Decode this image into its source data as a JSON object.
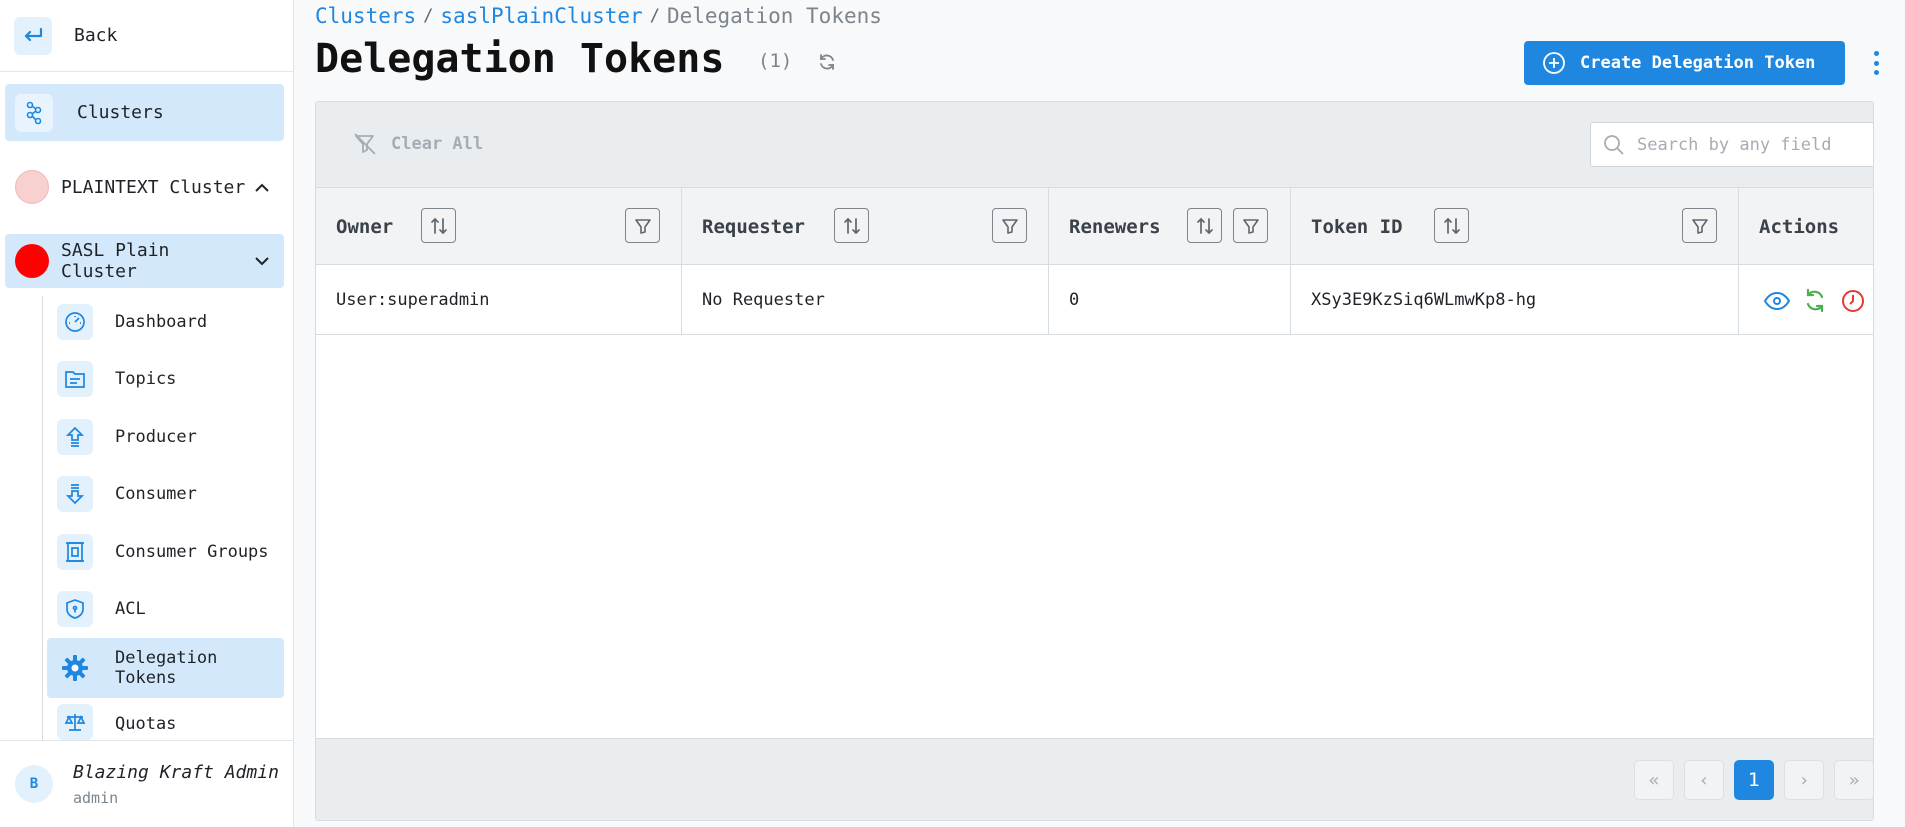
{
  "sidebar": {
    "back_label": "Back",
    "clusters_label": "Clusters",
    "clusters": [
      {
        "name": "PLAINTEXT Cluster",
        "color": "#f8d0d0",
        "expanded": false
      },
      {
        "name": "SASL Plain Cluster",
        "color": "#ff0000",
        "expanded": true
      }
    ],
    "nav_items": [
      {
        "label": "Dashboard",
        "icon": "gauge-icon"
      },
      {
        "label": "Topics",
        "icon": "folder-icon"
      },
      {
        "label": "Producer",
        "icon": "upload-arrow-icon"
      },
      {
        "label": "Consumer",
        "icon": "download-arrow-icon"
      },
      {
        "label": "Consumer Groups",
        "icon": "group-icon"
      },
      {
        "label": "ACL",
        "icon": "shield-icon"
      },
      {
        "label": "Delegation Tokens",
        "icon": "gear-icon",
        "active": true
      },
      {
        "label": "Quotas",
        "icon": "scale-icon"
      }
    ],
    "user": {
      "initial": "B",
      "name": "Blazing Kraft Admin",
      "role": "admin"
    }
  },
  "breadcrumb": {
    "items": [
      "Clusters",
      "saslPlainCluster"
    ],
    "current": "Delegation Tokens",
    "separator": "/"
  },
  "header": {
    "title": "Delegation Tokens",
    "count": "(1)",
    "create_label": "Create Delegation Token"
  },
  "toolbar": {
    "clear_all_label": "Clear All",
    "search_placeholder": "Search by any field"
  },
  "table": {
    "columns": [
      "Owner",
      "Requester",
      "Renewers",
      "Token ID",
      "Actions"
    ],
    "rows": [
      {
        "owner": "User:superadmin",
        "requester": "No Requester",
        "renewers": "0",
        "token_id": "XSy3E9KzSiq6WLmwKp8-hg"
      }
    ]
  },
  "pagination": {
    "first": "«",
    "prev": "‹",
    "current": "1",
    "next": "›",
    "last": "»"
  },
  "colors": {
    "accent": "#1f87e0",
    "active_bg": "#d3e9fb",
    "renew": "#4caf50",
    "expire": "#e53935"
  }
}
